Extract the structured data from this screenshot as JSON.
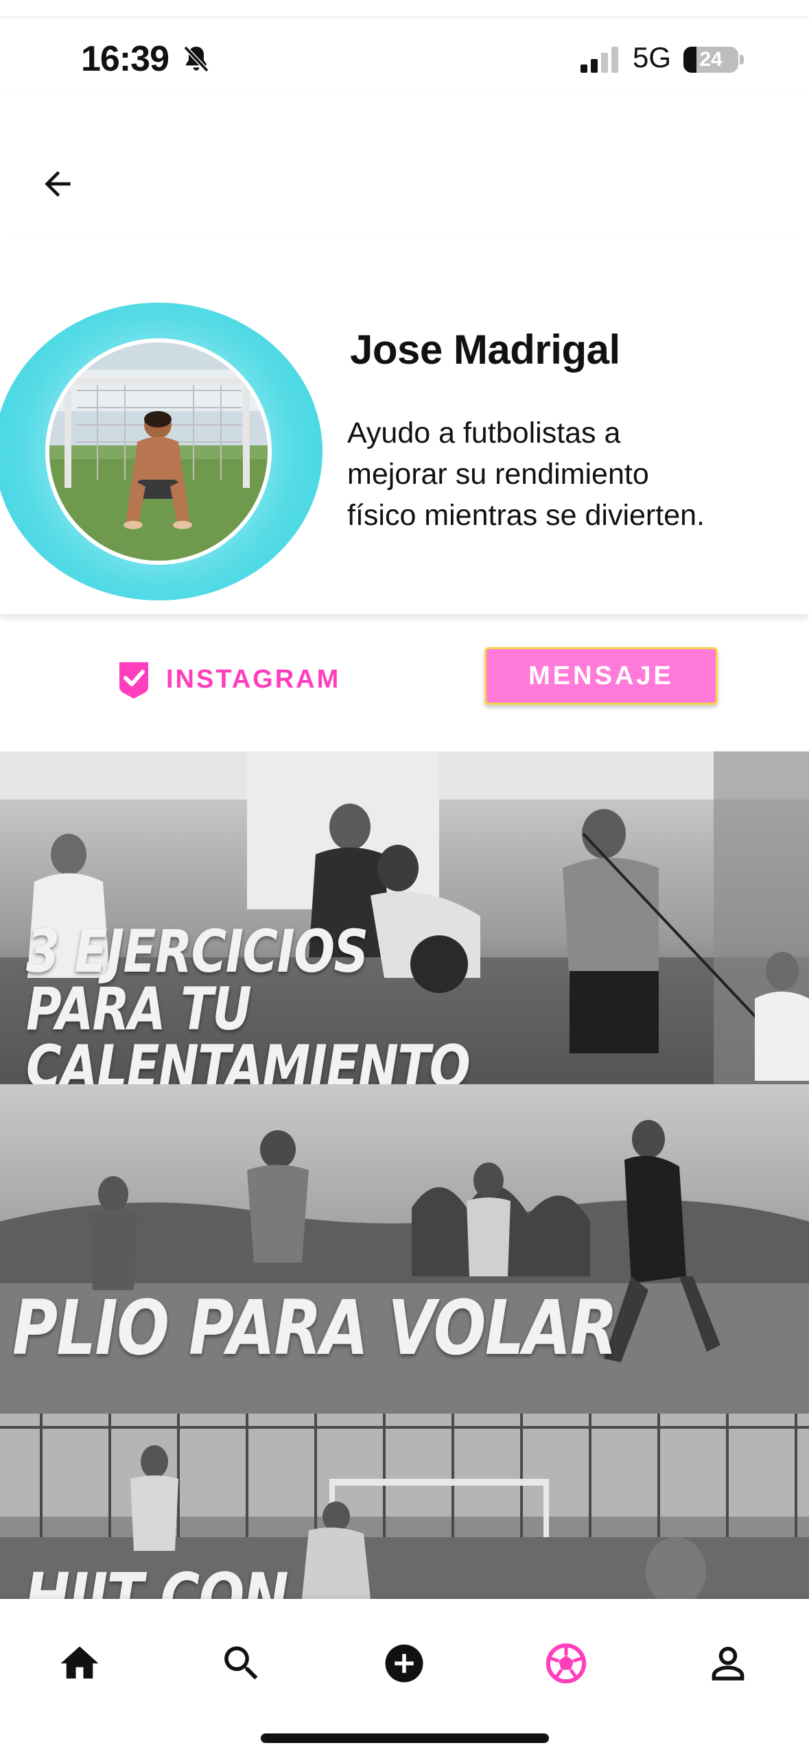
{
  "status_bar": {
    "time": "16:39",
    "network": "5G",
    "battery_percent": "24",
    "battery_level": 0.24,
    "icons": [
      "bell-off-icon",
      "signal-icon",
      "battery-icon"
    ]
  },
  "header": {
    "back_icon": "arrow-left-icon"
  },
  "profile": {
    "name": "Jose Madrigal",
    "bio_lines": [
      "Ayudo a futbolistas a",
      "mejorar su rendimiento",
      "físico mientras se divierten."
    ]
  },
  "actions": {
    "instagram_label": "INSTAGRAM",
    "instagram_icon": "verified-badge-icon",
    "message_label": "MENSAJE"
  },
  "videos": [
    {
      "title_lines": [
        "3 EJERCICIOS",
        "PARA TU CALENTAMIENTO"
      ]
    },
    {
      "title_lines": [
        "PLIO PARA VOLAR"
      ]
    },
    {
      "title_lines": [
        "HIIT CON"
      ]
    }
  ],
  "bottom_nav": {
    "items": [
      {
        "name": "home",
        "icon": "home-icon"
      },
      {
        "name": "search",
        "icon": "search-icon"
      },
      {
        "name": "add",
        "icon": "add-circle-icon"
      },
      {
        "name": "football",
        "icon": "football-icon",
        "active": true
      },
      {
        "name": "profile",
        "icon": "person-icon"
      }
    ]
  },
  "colors": {
    "accent_pink": "#ff3ebd",
    "button_pink": "#ff7ad9",
    "button_border": "#f7d84a",
    "halo_cyan": "#36d2df"
  }
}
